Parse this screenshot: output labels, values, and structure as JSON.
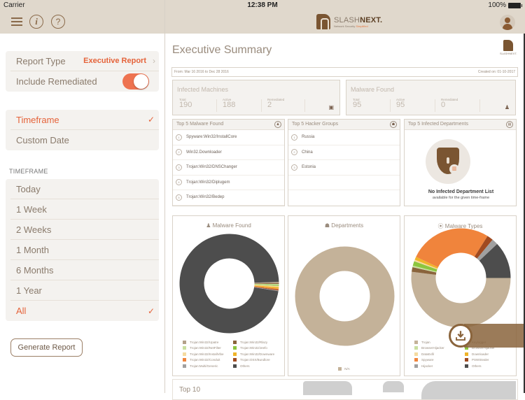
{
  "status_bar": {
    "carrier": "Carrier",
    "time": "12:38 PM",
    "battery": "100%"
  },
  "header": {
    "brand_prefix": "SLASH",
    "brand_suffix": "NEXT.",
    "tagline_prefix": "Network Security",
    "tagline_suffix": "Simplified",
    "menu_icon": "hamburger-icon",
    "info_icon_glyph": "i",
    "help_icon_glyph": "?"
  },
  "sidebar": {
    "settings": [
      {
        "label": "Report Type",
        "value": "Executive Report"
      },
      {
        "label": "Include Remediated",
        "toggle_on": true
      }
    ],
    "mode": [
      {
        "label": "Timeframe",
        "selected": true
      },
      {
        "label": "Custom Date",
        "selected": false
      }
    ],
    "timeframe_section_label": "TIMEFRAME",
    "timeframes": [
      {
        "label": "Today",
        "selected": false
      },
      {
        "label": "1 Week",
        "selected": false
      },
      {
        "label": "2 Weeks",
        "selected": false
      },
      {
        "label": "1 Month",
        "selected": false
      },
      {
        "label": "6 Months",
        "selected": false
      },
      {
        "label": "1 Year",
        "selected": false
      },
      {
        "label": "All",
        "selected": true
      }
    ],
    "generate_button": "Generate Report",
    "check_glyph": "✓",
    "chevron_glyph": "›"
  },
  "report": {
    "title": "Executive Summary",
    "mini_logo_text": "SLASHNEXT.",
    "date_range": "From: Mar 16 2016 to Dec 28 2016",
    "created_on": "Created on: 01-10-2017",
    "infected_machines": {
      "title": "Infected Machines",
      "total_label": "Total",
      "total": "190",
      "active_label": "Active",
      "active": "188",
      "remediated_label": "Remediated",
      "remediated": "2"
    },
    "malware_found": {
      "title": "Malware Found",
      "total_label": "Total",
      "total": "95",
      "active_label": "Active",
      "active": "95",
      "remediated_label": "Remediated",
      "remediated": "0"
    },
    "top_malware": {
      "title": "Top 5 Malware Found",
      "items": [
        "Spyware:Win32/InstallCore",
        "Win32.Downloader",
        "Trojan:Win32/DNSChanger",
        "Trojan:Win32/Diplugem",
        "Trojan:Win32/Bedep"
      ]
    },
    "top_hackers": {
      "title": "Top 5 Hacker Groups",
      "items": [
        "Russia",
        "China",
        "Estonia"
      ]
    },
    "top_departments": {
      "title": "Top 5 Infected Departments",
      "empty_title": "No Infected Department List",
      "empty_subtitle": "available for the given time-frame"
    },
    "map_title": "Top 10"
  },
  "chart_data": [
    {
      "type": "pie",
      "title": "Malware Found",
      "donut": true,
      "legend": "bottom",
      "categories": [
        "Trojan:Win32/Upatre",
        "Trojan:Win32/Rlazy",
        "Trojan:Win32/NetFilter",
        "Trojan:Win32/Jeefo",
        "Trojan:Win32/InstallVibe",
        "Trojan:Win32/Downware",
        "Trojan:Win32/Conduit",
        "Trojan:OSX/Bundlore",
        "Trojan:Multi/Generic",
        "Others"
      ],
      "colors": [
        "#b3a08a",
        "#8a643c",
        "#c9dfa0",
        "#8cc63f",
        "#f5dba0",
        "#f0b429",
        "#f0843c",
        "#a04a20",
        "#a0a0a0",
        "#4d4d4d"
      ],
      "values": [
        0.4,
        0.3,
        0.3,
        0.3,
        0.4,
        0.5,
        0.3,
        0.3,
        0.2,
        97.0
      ]
    },
    {
      "type": "pie",
      "title": "Departments",
      "donut": true,
      "legend": "bottom",
      "categories": [
        "N/A"
      ],
      "colors": [
        "#c4b299"
      ],
      "values": [
        100
      ]
    },
    {
      "type": "pie",
      "title": "Malware Types",
      "donut": true,
      "legend": "bottom",
      "categories": [
        "Trojan",
        "Keylogger",
        "BrowserHijacker",
        "BrowserHijacker",
        "DataExfil",
        "Downloader",
        "Spyware",
        "PSWStealer",
        "Hijacker",
        "Others"
      ],
      "colors": [
        "#c4b299",
        "#8a643c",
        "#c9dfa0",
        "#8cc63f",
        "#f5dba0",
        "#f0b429",
        "#f0843c",
        "#a04a20",
        "#a0a0a0",
        "#4d4d4d"
      ],
      "values": [
        52,
        1.5,
        0.5,
        1.5,
        0.5,
        1,
        27,
        2,
        2,
        12
      ]
    }
  ]
}
